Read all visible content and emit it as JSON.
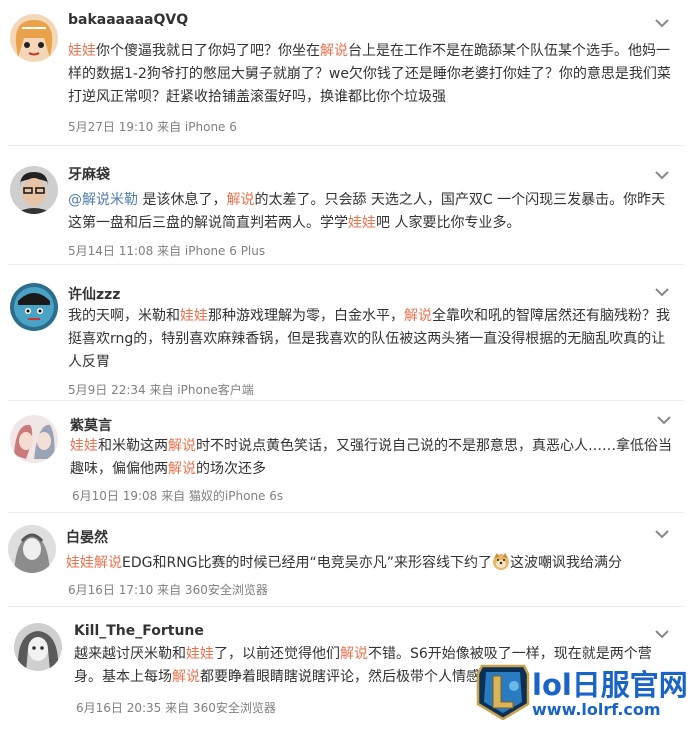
{
  "comments": [
    {
      "username": "bakaaaaaaQVQ",
      "lines": [
        [
          [
            "kw",
            "娃娃"
          ],
          [
            "t",
            "你个傻逼我就日了你妈了吧？你坐在"
          ],
          [
            "kw",
            "解说"
          ],
          [
            "t",
            "台上是在工作不是在跪舔某个队伍某个选手。他妈一"
          ]
        ],
        [
          [
            "t",
            "样的数据1-2狗爷打的憋屈大舅子就崩了？we欠你钱了还是睡你老婆打你娃了？你的意思是我们菜"
          ]
        ],
        [
          [
            "t",
            "打逆风正常呗？赶紧收拾铺盖滚蛋好吗，换谁都比你个垃圾强"
          ]
        ]
      ],
      "meta": "5月27日 19:10 来自 iPhone 6"
    },
    {
      "username": "牙麻袋",
      "lines": [
        [
          [
            "at",
            "@解说米勒"
          ],
          [
            "t",
            " 是该休息了，"
          ],
          [
            "kw",
            "解说"
          ],
          [
            "t",
            "的太差了。只会舔 天选之人，国产双C 一个闪现三发暴击。你昨天"
          ]
        ],
        [
          [
            "t",
            "这第一盘和后三盘的解说简直判若两人。学学"
          ],
          [
            "kw",
            "娃娃"
          ],
          [
            "t",
            "吧 人家要比你专业多。"
          ]
        ]
      ],
      "meta": "5月14日 11:08 来自 iPhone 6 Plus"
    },
    {
      "username": "许仙zzz",
      "lines": [
        [
          [
            "t",
            "我的天啊，米勒和"
          ],
          [
            "kw",
            "娃娃"
          ],
          [
            "t",
            "那种游戏理解为零，白金水平，"
          ],
          [
            "kw",
            "解说"
          ],
          [
            "t",
            "全靠吹和吼的智障居然还有脑残粉？我"
          ]
        ],
        [
          [
            "t",
            "挺喜欢rng的，特别喜欢麻辣香锅，但是我喜欢的队伍被这两头猪一直没得根据的无脑乱吹真的让"
          ]
        ],
        [
          [
            "t",
            "人反胃"
          ]
        ]
      ],
      "meta": "5月9日 22:34 来自 iPhone客户端"
    },
    {
      "username": "紫莫言",
      "lines": [
        [
          [
            "kw",
            "娃娃"
          ],
          [
            "t",
            "和米勒这两"
          ],
          [
            "kw",
            "解说"
          ],
          [
            "t",
            "时不时说点黄色笑话，又强行说自己说的不是那意思，真恶心人……拿低俗当"
          ]
        ],
        [
          [
            "t",
            "趣味，偏偏他两"
          ],
          [
            "kw",
            "解说"
          ],
          [
            "t",
            "的场次还多"
          ]
        ]
      ],
      "meta": "6月10日 19:08 来自 猫奴的iPhone 6s"
    },
    {
      "username": "白晏然",
      "lines": [
        [
          [
            "kw",
            "娃娃解说"
          ],
          [
            "t",
            "EDG和RNG比赛的时候已经用“电竞吴亦凡”来形容线下约了"
          ],
          [
            "emoji",
            "doge-emoji"
          ],
          [
            "t",
            "这波嘲讽我给满分"
          ]
        ]
      ],
      "meta": "6月16日 17:10 来自 360安全浏览器"
    },
    {
      "username": "Kill_The_Fortune",
      "lines": [
        [
          [
            "t",
            "越来越讨厌米勒和"
          ],
          [
            "kw",
            "娃娃"
          ],
          [
            "t",
            "了，以前还觉得他们"
          ],
          [
            "kw",
            "解说"
          ],
          [
            "t",
            "不错。S6开始像被吸了一样，现在就是两个营"
          ]
        ],
        [
          [
            "t",
            "身。基本上每场"
          ],
          [
            "kw",
            "解说"
          ],
          [
            "t",
            "都要睁着眼睛瞎说瞎评论，然后极带个人情感"
          ]
        ]
      ],
      "meta": "6月16日 20:35 来自 360安全浏览器"
    }
  ],
  "watermark": {
    "title": "lol日服官网",
    "url": "www.lolrf.com"
  },
  "colors": {
    "keyword": "#eb7350",
    "mention": "#507daf",
    "meta": "#808080",
    "watermark": "#1a63c7"
  }
}
